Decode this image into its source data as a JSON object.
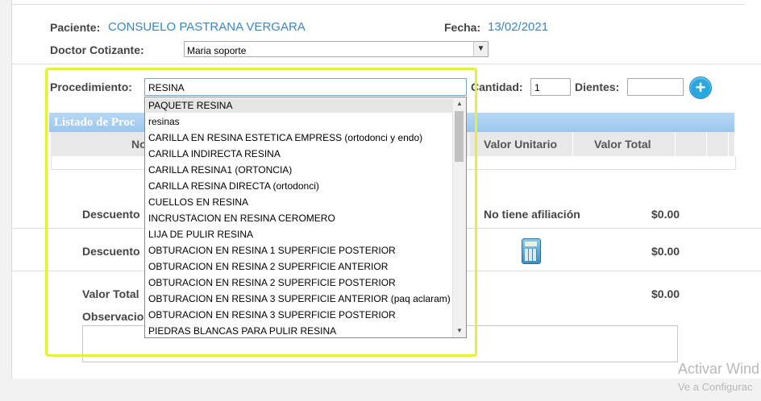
{
  "patient": {
    "label": "Paciente:",
    "name": "CONSUELO PASTRANA VERGARA"
  },
  "date": {
    "label": "Fecha:",
    "value": "13/02/2021"
  },
  "doctor": {
    "label": "Doctor Cotizante:",
    "selected": "Maria soporte"
  },
  "procedure": {
    "label": "Procedimiento:",
    "value": "RESINA",
    "options": [
      "PAQUETE RESINA",
      "resinas",
      "CARILLA EN RESINA ESTETICA EMPRESS (ortodonci y endo)",
      "CARILLA INDIRECTA RESINA",
      "CARILLA RESINA1 (ORTONCIA)",
      "CARILLA RESINA DIRECTA (ortodonci)",
      "CUELLOS EN RESINA",
      "INCRUSTACION EN RESINA CEROMERO",
      "LIJA DE PULIR RESINA",
      "OBTURACION EN RESINA 1 SUPERFICIE POSTERIOR",
      "OBTURACION EN RESINA 2 SUPERFICIE ANTERIOR",
      "OBTURACION EN RESINA 2 SUPERFICIE POSTERIOR",
      "OBTURACION EN RESINA 3 SUPERFICIE ANTERIOR (paq aclaram)",
      "OBTURACION EN RESINA 3 SUPERFICIE POSTERIOR",
      "PIEDRAS BLANCAS PARA PULIR RESINA"
    ]
  },
  "quantity": {
    "label": "Cantidad:",
    "value": "1"
  },
  "teeth": {
    "label": "Dientes:",
    "value": ""
  },
  "list": {
    "title": "Listado de Proc",
    "col_name": "No",
    "col_unit": "Valor Unitario",
    "col_total": "Valor Total"
  },
  "summary": {
    "discount1_label": "Descuento",
    "affiliation_text": "No tiene afiliación",
    "discount1_value": "$0.00",
    "discount2_label": "Descuento",
    "discount2_value": "$0.00",
    "total_label": "Valor Total",
    "total_value": "$0.00",
    "observations_label": "Observacio"
  },
  "watermark": {
    "line1": "Activar Wind",
    "line2": "Ve a Configurac"
  },
  "colors": {
    "accent": "#3a87c0",
    "highlight": "#e2f23a",
    "header": "#9cc6ee"
  }
}
